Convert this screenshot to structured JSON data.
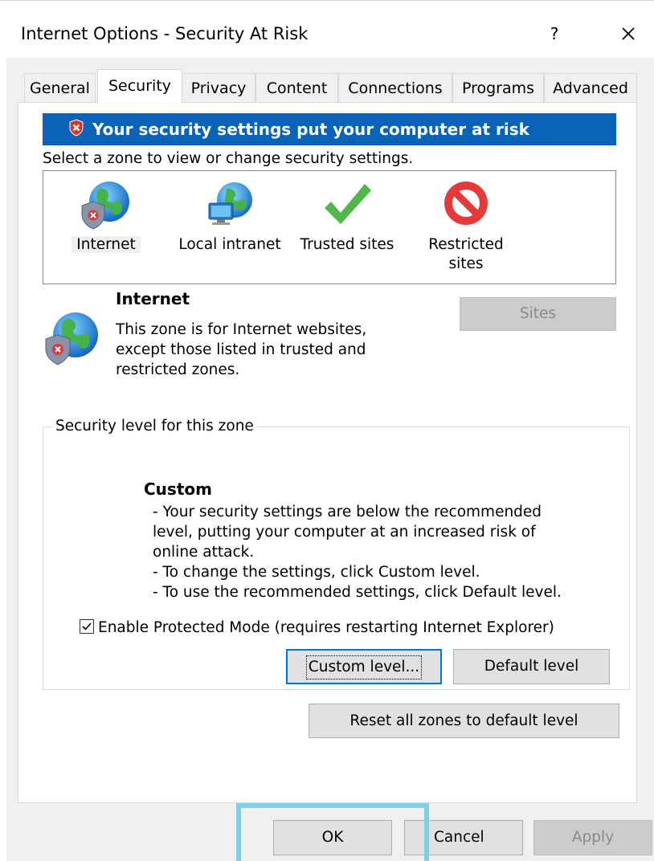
{
  "window": {
    "title": "Internet Options - Security At Risk",
    "help_label": "?",
    "close_icon": "close-icon"
  },
  "tabs": [
    {
      "label": "General",
      "active": false
    },
    {
      "label": "Security",
      "active": true
    },
    {
      "label": "Privacy",
      "active": false
    },
    {
      "label": "Content",
      "active": false
    },
    {
      "label": "Connections",
      "active": false
    },
    {
      "label": "Programs",
      "active": false
    },
    {
      "label": "Advanced",
      "active": false
    }
  ],
  "security": {
    "warning_banner": "Your security settings put your computer at risk",
    "warning_color": "#0a63b8",
    "instruction": "Select a zone to view or change security settings.",
    "zones": [
      {
        "label": "Internet",
        "icon": "globe-shield-icon",
        "selected": true
      },
      {
        "label": "Local intranet",
        "icon": "intranet-globe-icon",
        "selected": false
      },
      {
        "label": "Trusted sites",
        "icon": "checkmark-icon",
        "selected": false
      },
      {
        "label_line1": "Restricted",
        "label_line2": "sites",
        "icon": "restricted-icon",
        "selected": false
      }
    ],
    "selected_zone": {
      "title": "Internet",
      "description_lines": [
        "This zone is for Internet websites,",
        "except those listed in trusted and",
        "restricted zones."
      ]
    },
    "sites_button": "Sites",
    "level_group": {
      "legend": "Security level for this zone",
      "level_name": "Custom",
      "level_description": [
        "- Your security settings are below the recommended",
        "level, putting your computer at an increased risk of",
        "online attack.",
        "- To change the settings, click Custom level.",
        "- To use the recommended settings, click Default level."
      ],
      "protected_mode_label": "Enable Protected Mode (requires restarting Internet Explorer)",
      "protected_mode_checked": true,
      "custom_level_button": "Custom level...",
      "default_level_button": "Default level"
    },
    "reset_all_button": "Reset all zones to default level"
  },
  "footer": {
    "ok_button": "OK",
    "cancel_button": "Cancel",
    "apply_button": "Apply",
    "highlight_color": "#7fcfe9"
  }
}
